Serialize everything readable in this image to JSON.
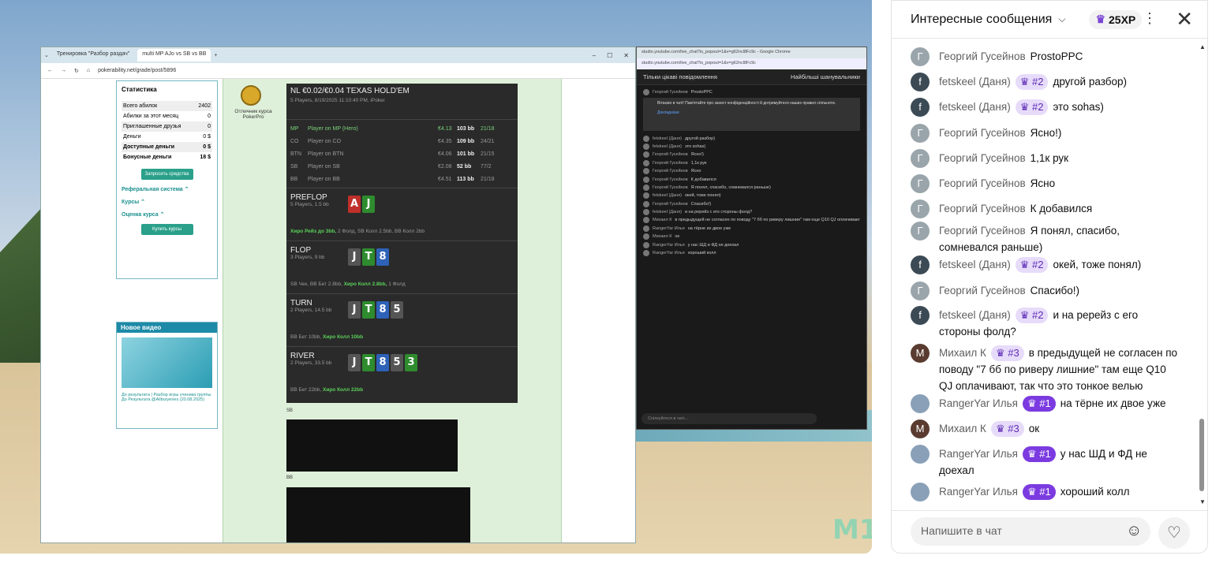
{
  "stream": {
    "left_browser": {
      "tabs": [
        "Тренировка \"Разбор раздач\"",
        "multi MP AJo vs SB vs BB"
      ],
      "url": "pokerability.net/grade/post/5896",
      "stats": {
        "title": "Статистика",
        "rows": [
          {
            "label": "Всего абилок",
            "value": "2402"
          },
          {
            "label": "Абилки за этот месяц",
            "value": "0"
          },
          {
            "label": "Приглашенные друзья",
            "value": "0"
          },
          {
            "label": "Деньги",
            "value": "0 $"
          },
          {
            "label": "Доступные деньги",
            "value": "0 $"
          },
          {
            "label": "Бонусные деньги",
            "value": "18 $"
          }
        ],
        "request_btn": "Запросить средства",
        "links": [
          "Реферальная система ⌃",
          "Курсы ⌃",
          "Оценка курса ⌃"
        ],
        "buy_btn": "Купить курсы"
      },
      "video": {
        "header": "Новое видео",
        "caption": "До результата | Разбор игры ученика группы До Результата @Ailburyenes (20.08.2025)"
      },
      "medal_caption": "Отличник курса PokerPro",
      "hand": {
        "title": "NL €0.02/€0.04 TEXAS HOLD'EM",
        "subtitle": "5 Players, 8/19/2025 11:10:40 PM, iPoker",
        "players": [
          {
            "pos": "MP",
            "name": "Player on MP (Hero)",
            "stack": "€4.13",
            "bb": "103 bb",
            "ratio": "21/18",
            "hero": true
          },
          {
            "pos": "CO",
            "name": "Player on CO",
            "stack": "€4.35",
            "bb": "109 bb",
            "ratio": "24/21",
            "hero": false
          },
          {
            "pos": "BTN",
            "name": "Player on BTN",
            "stack": "€4.06",
            "bb": "101 bb",
            "ratio": "21/15",
            "hero": false
          },
          {
            "pos": "SB",
            "name": "Player on SB",
            "stack": "€2.08",
            "bb": "52 bb",
            "ratio": "77/2",
            "hero": false
          },
          {
            "pos": "BB",
            "name": "Player on BB",
            "stack": "€4.51",
            "bb": "113 bb",
            "ratio": "21/18",
            "hero": false
          }
        ],
        "streets": [
          {
            "name": "PREFLOP",
            "sub": "5 Players, 1.5 bb",
            "cards": [
              {
                "r": "A",
                "c": "r"
              },
              {
                "r": "J",
                "c": "gr"
              }
            ],
            "pre": "",
            "hl": "Хиро Рейз до 3bb,",
            "post": " 2 Фолд, SB Колл 2.5bb, BB Колл 2bb"
          },
          {
            "name": "FLOP",
            "sub": "3 Players, 9 bb",
            "cards": [
              {
                "r": "J",
                "c": "g"
              },
              {
                "r": "T",
                "c": "gr"
              },
              {
                "r": "8",
                "c": "b"
              }
            ],
            "pre": "SB Чек, BB Бет 2.8bb, ",
            "hl": "Хиро Колл 2.8bb,",
            "post": " 1 Фолд"
          },
          {
            "name": "TURN",
            "sub": "2 Players, 14.5 bb",
            "cards": [
              {
                "r": "J",
                "c": "g"
              },
              {
                "r": "T",
                "c": "gr"
              },
              {
                "r": "8",
                "c": "b"
              },
              {
                "r": "5",
                "c": "g"
              }
            ],
            "pre": "BB Бет 10bb, ",
            "hl": "Хиро Колл 10bb",
            "post": ""
          },
          {
            "name": "RIVER",
            "sub": "2 Players, 33.5 bb",
            "cards": [
              {
                "r": "J",
                "c": "g"
              },
              {
                "r": "T",
                "c": "gr"
              },
              {
                "r": "8",
                "c": "b"
              },
              {
                "r": "5",
                "c": "g"
              },
              {
                "r": "3",
                "c": "gr"
              }
            ],
            "pre": "BB Бет 22bb, ",
            "hl": "Хиро Колл 22bb",
            "post": ""
          }
        ]
      },
      "hud_labels": [
        "SB",
        "BB"
      ]
    },
    "right_browser": {
      "tab": "studio.youtube.com/live_chat?is_popout=1&v=g62ncl8Fc9c - Google Chrome",
      "url": "studio.youtube.com/live_chat?is_popout=1&v=g62ncl8Fc9c",
      "header": "Тільки цікаві повідомлення",
      "sort": "Найбільші шанувальники",
      "notice": "Вітаємо в чаті! Пам'ятайте про захист конфіденційності й дотримуйтеся наших правил спільноти.",
      "notice_link": "Докладніше",
      "input_placeholder": "Спілкуйтеся в чаті..."
    },
    "watermark": "M1"
  },
  "chat": {
    "title": "Интересные сообщения",
    "xp": "25XP",
    "input_placeholder": "Напишите в чат",
    "messages": [
      {
        "author": "Георгий Гусейнов",
        "avatar": "Г",
        "avatar_style": "g",
        "badge": "",
        "text": "ProstoPPC"
      },
      {
        "author": "fetskeel (Даня)",
        "avatar": "f",
        "avatar_style": "f",
        "badge": "#2",
        "text": "другой разбор)"
      },
      {
        "author": "fetskeel (Даня)",
        "avatar": "f",
        "avatar_style": "f",
        "badge": "#2",
        "text": "это sohas)"
      },
      {
        "author": "Георгий Гусейнов",
        "avatar": "Г",
        "avatar_style": "g",
        "badge": "",
        "text": "Ясно!)"
      },
      {
        "author": "Георгий Гусейнов",
        "avatar": "Г",
        "avatar_style": "g",
        "badge": "",
        "text": "1,1к рук"
      },
      {
        "author": "Георгий Гусейнов",
        "avatar": "Г",
        "avatar_style": "g",
        "badge": "",
        "text": "Ясно"
      },
      {
        "author": "Георгий Гусейнов",
        "avatar": "Г",
        "avatar_style": "g",
        "badge": "",
        "text": "К добавился"
      },
      {
        "author": "Георгий Гусейнов",
        "avatar": "Г",
        "avatar_style": "g",
        "badge": "",
        "text": "Я понял, спасибо, сомневался раньше)"
      },
      {
        "author": "fetskeel (Даня)",
        "avatar": "f",
        "avatar_style": "f",
        "badge": "#2",
        "text": "окей, тоже понял)"
      },
      {
        "author": "Георгий Гусейнов",
        "avatar": "Г",
        "avatar_style": "g",
        "badge": "",
        "text": "Спасибо!)"
      },
      {
        "author": "fetskeel (Даня)",
        "avatar": "f",
        "avatar_style": "f",
        "badge": "#2",
        "text": "и на ререйз с его стороны фолд?"
      },
      {
        "author": "Михаил К",
        "avatar": "M",
        "avatar_style": "m",
        "badge": "#3",
        "text": "в предыдущей не согласен по поводу \"7 бб по риверу лишние\" там еще Q10 QJ оплачивают, так что это тонкое велью"
      },
      {
        "author": "RangerYar Илья",
        "avatar": "",
        "avatar_style": "r",
        "badge": "#1",
        "text": "на тёрне их двое уже"
      },
      {
        "author": "Михаил К",
        "avatar": "M",
        "avatar_style": "m",
        "badge": "#3",
        "text": "ок"
      },
      {
        "author": "RangerYar Илья",
        "avatar": "",
        "avatar_style": "r",
        "badge": "#1",
        "text": "у нас ШД и ФД не доехал"
      },
      {
        "author": "RangerYar Илья",
        "avatar": "",
        "avatar_style": "r",
        "badge": "#1",
        "text": "хороший колл"
      }
    ]
  }
}
